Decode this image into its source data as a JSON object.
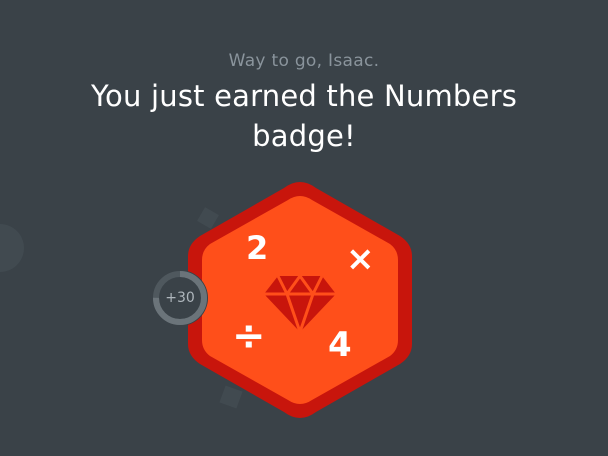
{
  "greeting": "Way to go, Isaac.",
  "headline": "You just earned the Numbers badge!",
  "badge": {
    "symbols": {
      "top_left": "2",
      "top_right": "×",
      "bottom_left": "÷",
      "bottom_right": "4"
    },
    "colors": {
      "outer": "#c8150c",
      "inner": "#ff4f1a",
      "gem": "#c8150c"
    }
  },
  "points": {
    "label": "+30",
    "progress": 0.75
  },
  "colors": {
    "background": "#3a4248",
    "subtitle": "#8a949c",
    "headline": "#ffffff"
  }
}
